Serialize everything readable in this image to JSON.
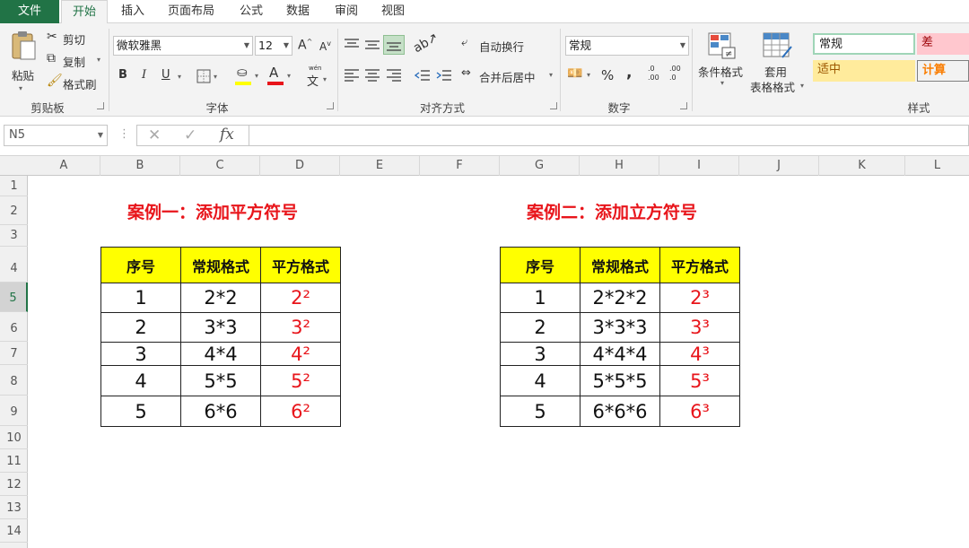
{
  "ribbon_tabs": [
    "文件",
    "开始",
    "插入",
    "页面布局",
    "公式",
    "数据",
    "审阅",
    "视图"
  ],
  "clipboard": {
    "paste": "粘贴",
    "cut": "剪切",
    "copy": "复制",
    "format_painter": "格式刷",
    "group": "剪贴板"
  },
  "font": {
    "name": "微软雅黑",
    "size": "12",
    "bold": "B",
    "italic": "I",
    "underline": "U",
    "grow": "A",
    "shrink": "A",
    "color_a": "A",
    "phonetic": "文",
    "group": "字体"
  },
  "alignment": {
    "wrap": "自动换行",
    "merge": "合并后居中",
    "group": "对齐方式"
  },
  "number": {
    "format": "常规",
    "percent": "%",
    "comma": ",",
    "inc": ".0",
    "inc2": ".00",
    "dec": ".00",
    "dec2": ".0",
    "group": "数字"
  },
  "styles": {
    "conditional": "条件格式",
    "table1": "套用",
    "table2": "表格格式",
    "normal": "常规",
    "bad": "差",
    "neutral": "适中",
    "calc": "计算",
    "group": "样式"
  },
  "formula_bar": {
    "name_box": "N5",
    "fx": "fx",
    "formula": ""
  },
  "columns": [
    "A",
    "B",
    "C",
    "D",
    "E",
    "F",
    "G",
    "H",
    "I",
    "J",
    "K",
    "L"
  ],
  "rows": [
    "1",
    "2",
    "3",
    "4",
    "5",
    "6",
    "7",
    "8",
    "9",
    "10",
    "11",
    "12",
    "13",
    "14"
  ],
  "selected_row": "5",
  "example1": {
    "title": "案例一：添加平方符号",
    "headers": [
      "序号",
      "常规格式",
      "平方格式"
    ],
    "rows": [
      [
        "1",
        "2*2",
        "2²"
      ],
      [
        "2",
        "3*3",
        "3²"
      ],
      [
        "3",
        "4*4",
        "4²"
      ],
      [
        "4",
        "5*5",
        "5²"
      ],
      [
        "5",
        "6*6",
        "6²"
      ]
    ]
  },
  "example2": {
    "title": "案例二：添加立方符号",
    "headers": [
      "序号",
      "常规格式",
      "平方格式"
    ],
    "rows": [
      [
        "1",
        "2*2*2",
        "2³"
      ],
      [
        "2",
        "3*3*3",
        "3³"
      ],
      [
        "3",
        "4*4*4",
        "4³"
      ],
      [
        "4",
        "5*5*5",
        "5³"
      ],
      [
        "5",
        "6*6*6",
        "6³"
      ]
    ]
  },
  "colors": {
    "excel_green": "#217346",
    "title_red": "#e8151b",
    "header_yellow": "#ffff00"
  }
}
